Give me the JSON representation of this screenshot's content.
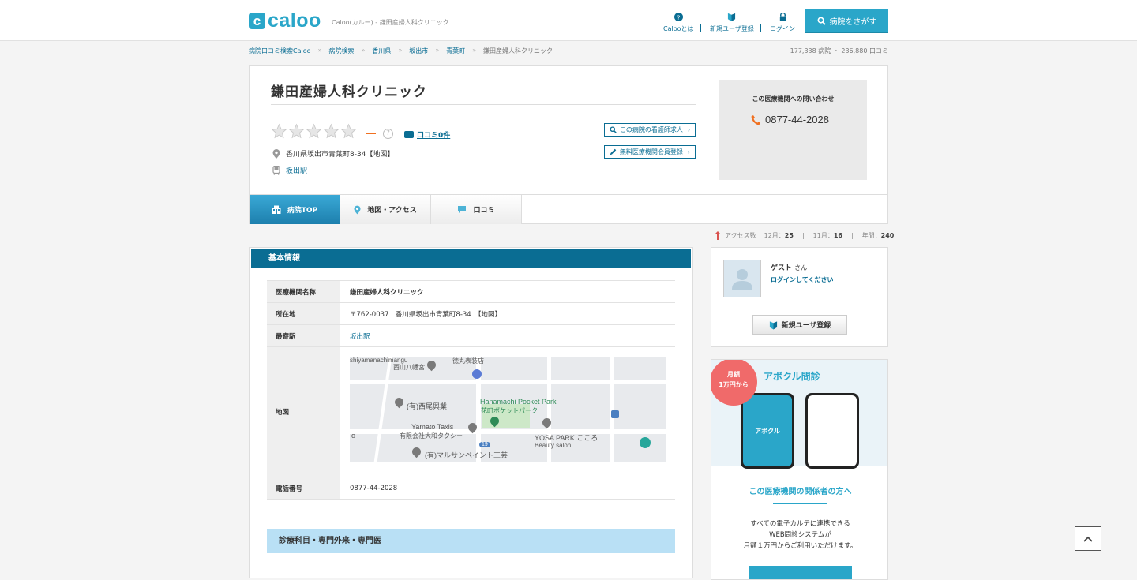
{
  "header": {
    "logo_letter": "c",
    "logo_word": "caloo",
    "tagline": "Caloo(カルー) - 鎌田産婦人科クリニック",
    "nav": [
      {
        "label": "Calooとは",
        "icon": "question-circle-icon"
      },
      {
        "label": "新規ユーザ登録",
        "icon": "beginner-mark-icon"
      },
      {
        "label": "ログイン",
        "icon": "lock-icon"
      }
    ],
    "search_button": "病院をさがす"
  },
  "breadcrumb": {
    "items": [
      "病院口コミ検索Caloo",
      "病院検索",
      "香川県",
      "坂出市",
      "青葉町",
      "鎌田産婦人科クリニック"
    ],
    "separator": "»"
  },
  "site_stats": "177,338 病院 ・ 236,880 口コミ",
  "clinic": {
    "name": "鎌田産婦人科クリニック",
    "rating_display": "ー",
    "rating_help": "?",
    "reviews_link": "口コミ0件",
    "address": "香川県坂出市青葉町8-34【地図】",
    "station": "坂出駅",
    "nurse_button": "この病院の看護師求人",
    "member_button": "無料医療機関会員登録"
  },
  "contact": {
    "title": "この医療機関への問い合わせ",
    "phone": "0877-44-2028"
  },
  "tabs": [
    {
      "label": "病院TOP",
      "active": true
    },
    {
      "label": "地図・アクセス",
      "active": false
    },
    {
      "label": "口コミ",
      "active": false
    }
  ],
  "access": {
    "label": "アクセス数",
    "dec": "12月：",
    "dec_val": "25",
    "nov": "11月：",
    "nov_val": "16",
    "year": "年間：",
    "year_val": "240"
  },
  "basic_info": {
    "heading": "基本情報",
    "rows": [
      {
        "key": "医療機関名称",
        "value": "鎌田産婦人科クリニック"
      },
      {
        "key": "所在地",
        "value": "〒762-0037　香川県坂出市青葉町8-34　【地図】"
      },
      {
        "key": "最寄駅",
        "value": "坂出駅"
      },
      {
        "key": "地図",
        "value": ""
      },
      {
        "key": "電話番号",
        "value": "0877-44-2028"
      }
    ]
  },
  "map_labels": {
    "l1": "shiyamanachimangu",
    "l2": "西山八幡宮",
    "l3": "徳丸表装店",
    "l4": "(有)西尾興業",
    "l5": "Hanamachi Pocket Park",
    "l6": "花町ポケットパーク",
    "l7": "Yamato Taxis",
    "l8": "有限会社大和タクシー",
    "l9": "YOSA PARK こころ",
    "l10": "Beauty salon",
    "l11": "(有)マルサンペイント工芸",
    "l12": "19",
    "l13": "o"
  },
  "departments_heading": "診療科目・専門外来・専門医",
  "user_box": {
    "guest": "ゲスト",
    "honorific": "さん",
    "login_link": "ログインしてください",
    "register_button": "新規ユーザ登録"
  },
  "ad": {
    "badge_line1": "月額",
    "badge_line2": "1万円から",
    "brand": "アボクル問診",
    "phone_label": "アボクル",
    "title": "この医療機関の関係者の方へ",
    "text1": "すべての電子カルテに連携できる",
    "text2": "WEB問診システムが",
    "text3": "月額１万円からご利用いただけます。"
  },
  "colors": {
    "accent": "#2aa6c9",
    "primary": "#0a6d93",
    "light_blue": "#b9e0f5",
    "badge": "#f06a6a",
    "rating_dash": "#f07020"
  }
}
